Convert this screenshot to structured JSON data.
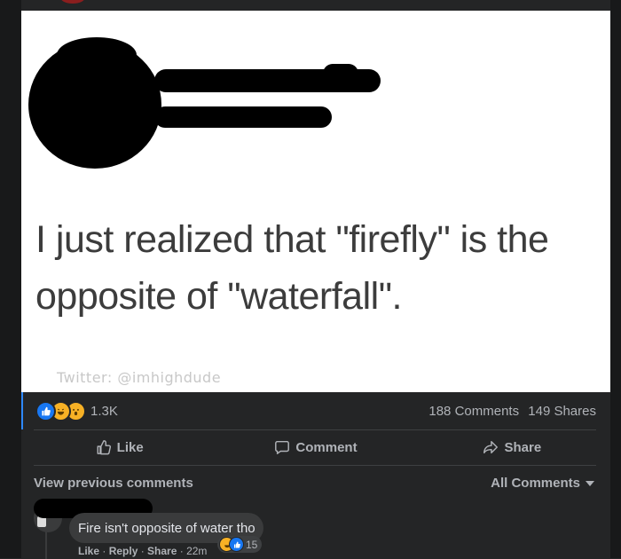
{
  "post": {
    "tweet_text": "I just realized that \"firefly\" is the opposite of \"waterfall\".",
    "twitter_credit": "Twitter: @imhighdude"
  },
  "stats": {
    "reaction_count": "1.3K",
    "comments": "188 Comments",
    "shares": "149 Shares"
  },
  "actions": {
    "like": "Like",
    "comment": "Comment",
    "share": "Share"
  },
  "comments_section": {
    "view_previous": "View previous comments",
    "filter": "All Comments"
  },
  "comment": {
    "text": "Fire isn't opposite of water tho",
    "reaction_count": "15",
    "like_label": "Like",
    "reply_label": "Reply",
    "share_label": "Share",
    "time": "22m"
  },
  "colors": {
    "background": "#242526",
    "accent": "#2d88ff",
    "like_blue": "#1877f2",
    "haha_yellow": "#f7b125",
    "muted_text": "#b0b3b8"
  },
  "icons": [
    "like-reaction-icon",
    "haha-reaction-icon",
    "wow-reaction-icon",
    "thumbs-up-icon",
    "comment-bubble-icon",
    "share-arrow-icon",
    "dropdown-caret-icon"
  ]
}
